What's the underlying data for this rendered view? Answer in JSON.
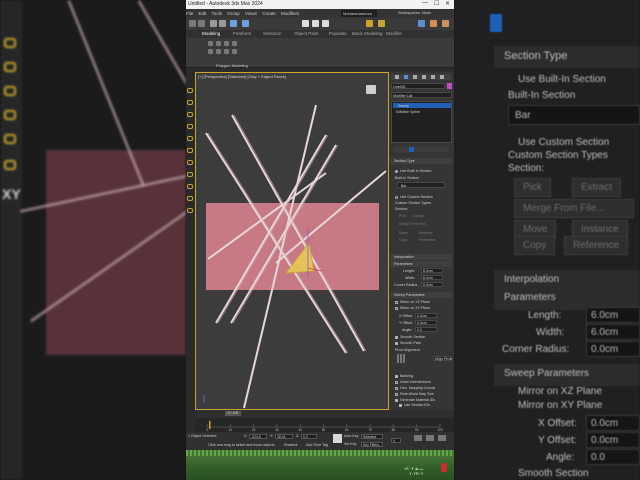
{
  "window": {
    "title": "Untitled - Autodesk 3ds Max 2024",
    "controls": [
      "—",
      "☐",
      "✕"
    ]
  },
  "menu": {
    "items": [
      "File",
      "Edit",
      "Tools",
      "Group",
      "Views",
      "Create",
      "Modifiers"
    ],
    "workspace_label": "Workspaces:",
    "workspace_value": "Main",
    "user_value": "Mohammadreza"
  },
  "ribbon": {
    "tabs": [
      "Modeling",
      "Freeform",
      "Selection",
      "Object Paint",
      "Populate",
      "Basic Modeling",
      "Modifier"
    ],
    "panel_label": "Polygon Modeling"
  },
  "viewport": {
    "label": "[+] [Perspective] [Standard] [Clay + Edged Faces]"
  },
  "command_panel": {
    "object_name": "Line001",
    "modifier_list": "Modifier List",
    "stack": [
      "Sweep",
      "Editable Spline"
    ],
    "section_type": {
      "header": "Section Type",
      "use_builtin": "Use Built-In Section",
      "builtin_label": "Built-In Section",
      "builtin_value": "Bar",
      "use_custom": "Use Custom Section",
      "custom_types": "Custom Section Types",
      "section_label": "Section:",
      "pick": "Pick",
      "extract": "Extract",
      "merge_file": "Merge From File...",
      "move": "Move",
      "instance": "Instance",
      "copy": "Copy",
      "reference": "Reference"
    },
    "interpolation": "Interpolation",
    "parameters": {
      "header": "Parameters",
      "length_label": "Length:",
      "length_value": "6.0cm",
      "width_label": "Width:",
      "width_value": "6.0cm",
      "corner_label": "Corner Radius:",
      "corner_value": "0.0cm"
    },
    "sweep_parameters": {
      "header": "Sweep Parameters",
      "mirror_xz": "Mirror on XZ Plane",
      "mirror_xy": "Mirror on XY Plane",
      "x_offset_label": "X Offset:",
      "x_offset_value": "0.0cm",
      "y_offset_label": "Y Offset:",
      "y_offset_value": "0.0cm",
      "angle_label": "Angle:",
      "angle_value": "0.0",
      "smooth_section": "Smooth Section",
      "smooth_path": "Smooth Path",
      "pivot_alignment": "Pivot Alignment",
      "align_pivot": "Align Pivot",
      "banking": "Banking",
      "union_intersections": "Union Intersections",
      "gen_mapping": "Gen. Mapping Coords",
      "real_world": "Real-World Map Size",
      "gen_material_ids": "Generate Material IDs",
      "use_section_ids": "Use Section IDs",
      "use_path_ids": "Use Path IDs"
    }
  },
  "timeline": {
    "slider": "0 / 100",
    "ticks": [
      "0",
      "10",
      "20",
      "30",
      "40",
      "50",
      "60",
      "70",
      "80",
      "90",
      "100"
    ]
  },
  "status": {
    "selection": "1 Object Selected",
    "prompt": "Click and drag to select and move objects",
    "x_label": "X:",
    "x_value": "-324.8",
    "y_label": "Y:",
    "y_value": "38.44",
    "z_label": "Z:",
    "z_value": "0.0",
    "grid": "Grid = 10.0cm",
    "enabled": "Enabled:",
    "auto_key": "Auto Key",
    "set_key": "Set Key",
    "selected": "Selected",
    "key_filters": "Key Filters...",
    "add_time_tag": "Add Time Tag",
    "frame": "0"
  },
  "taskbar": {
    "clock_line1": "۱۳:۰۳ ب.ظ",
    "clock_line2": "۲۰۲۴/۰۲"
  },
  "colors": {
    "selection_yellow": "#c9a52d",
    "rect_pink": "#c77a84",
    "tube_light": "#e8d6d8",
    "taskbar_green": "#3f7a2c",
    "accent_blue": "#1f5fb8"
  }
}
